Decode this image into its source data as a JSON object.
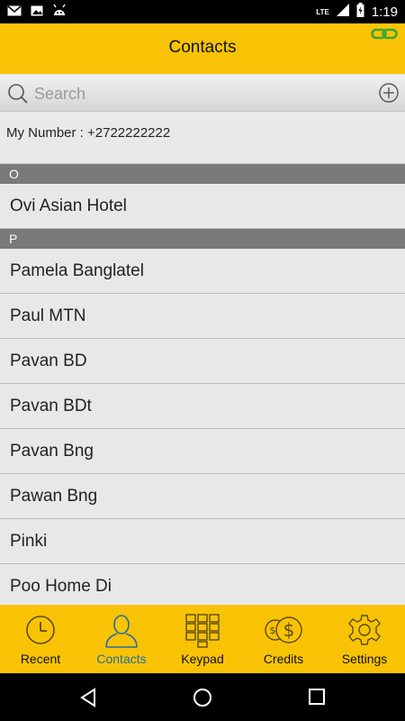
{
  "status_bar": {
    "time": "1:19",
    "network": "LTE",
    "notification_icons": [
      "gmail-icon",
      "image-icon",
      "android-icon"
    ]
  },
  "app_bar": {
    "title": "Contacts",
    "link_icon": "link-icon"
  },
  "search": {
    "placeholder": "Search"
  },
  "my_number": {
    "text": "My Number : +2722222222"
  },
  "sections": [
    {
      "letter": "O",
      "contacts": [
        "Ovi Asian Hotel"
      ]
    },
    {
      "letter": "P",
      "contacts": [
        "Pamela Banglatel",
        "Paul MTN",
        "Pavan BD",
        "Pavan BDt",
        "Pavan Bng",
        "Pawan Bng",
        "Pinki",
        "Poo Home Di"
      ]
    }
  ],
  "tabs": [
    {
      "label": "Recent",
      "icon": "clock-icon",
      "active": false
    },
    {
      "label": "Contacts",
      "icon": "person-icon",
      "active": true
    },
    {
      "label": "Keypad",
      "icon": "keypad-icon",
      "active": false
    },
    {
      "label": "Credits",
      "icon": "coins-icon",
      "active": false
    },
    {
      "label": "Settings",
      "icon": "gear-icon",
      "active": false
    }
  ],
  "colors": {
    "accent": "#f9c305",
    "active_tab": "#1f6fa3",
    "section_header": "#7a7a7a",
    "link_icon": "#3aa535"
  }
}
